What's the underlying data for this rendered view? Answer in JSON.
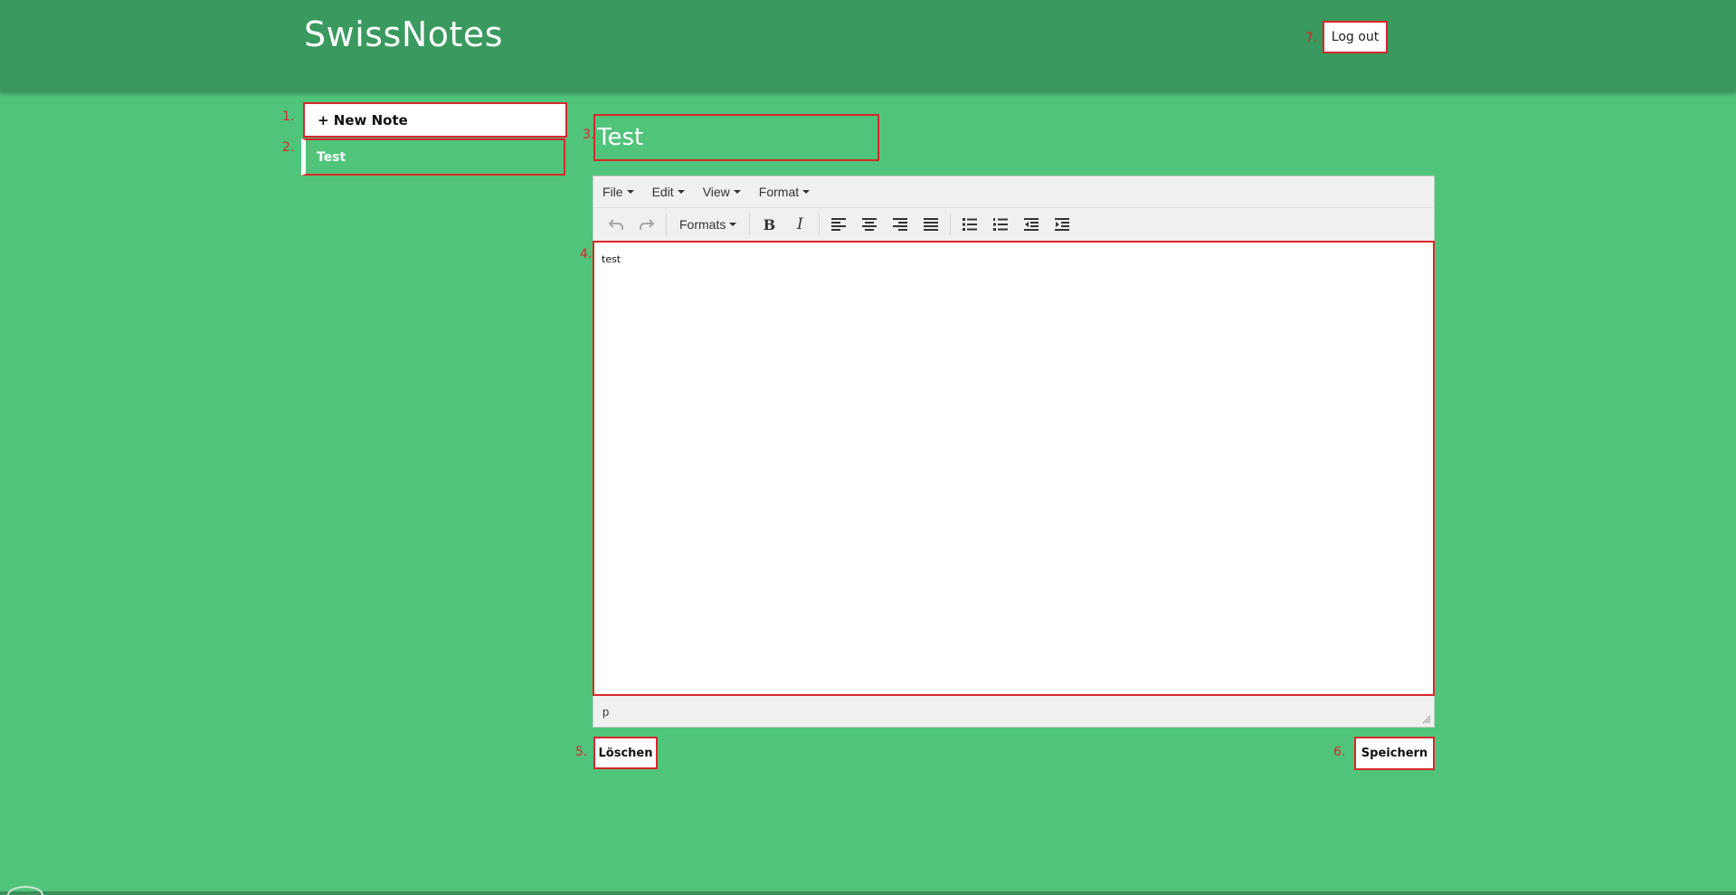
{
  "header": {
    "app_title": "SwissNotes",
    "logout_label": "Log out",
    "logout_annotation": "7."
  },
  "sidebar": {
    "new_note_label": "+ New Note",
    "new_note_annotation": "1.",
    "notes": [
      {
        "label": "Test",
        "annotation": "2."
      }
    ]
  },
  "note": {
    "title": "Test",
    "title_annotation": "3.",
    "content": "test",
    "content_annotation": "4."
  },
  "editor": {
    "menu": [
      "File",
      "Edit",
      "View",
      "Format"
    ],
    "formats_label": "Formats",
    "status_path": "p"
  },
  "actions": {
    "delete_label": "Löschen",
    "delete_annotation": "5.",
    "save_label": "Speichern",
    "save_annotation": "6."
  },
  "colors": {
    "background": "#51c47b",
    "header": "#3a995e",
    "annotation_red": "#d9262c"
  },
  "icons": [
    "undo-icon",
    "redo-icon",
    "bold-icon",
    "italic-icon",
    "align-left-icon",
    "align-center-icon",
    "align-right-icon",
    "align-justify-icon",
    "bullet-list-icon",
    "numbered-list-icon",
    "outdent-icon",
    "indent-icon",
    "resize-handle-icon"
  ]
}
